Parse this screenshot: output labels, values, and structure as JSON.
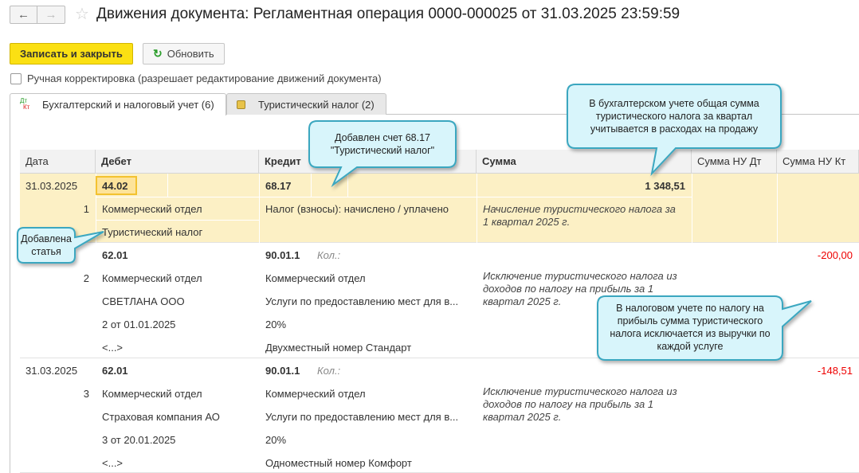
{
  "header": {
    "title": "Движения документа: Регламентная операция 0000-000025 от 31.03.2025 23:59:59",
    "back_icon": "arrow-left-icon",
    "forward_icon": "arrow-right-icon",
    "favorite_icon": "star-icon"
  },
  "toolbar": {
    "save_close_label": "Записать и закрыть",
    "refresh_label": "Обновить"
  },
  "manual_edit": {
    "label": "Ручная корректировка (разрешает редактирование движений документа)",
    "checked": false
  },
  "tabs": [
    {
      "icon_text_top": "Дт",
      "icon_text_bottom": "Кт",
      "label": "Бухгалтерский и налоговый учет (6)",
      "active": true
    },
    {
      "icon": "coins-icon",
      "label": "Туристический налог (2)",
      "active": false
    }
  ],
  "table": {
    "columns": [
      "Дата",
      "Дебет",
      "Кредит",
      "Сумма",
      "Сумма НУ Дт",
      "Сумма НУ Кт"
    ],
    "rows": [
      {
        "date": "31.03.2025",
        "num": "1",
        "debit": [
          "44.02",
          "Коммерческий отдел",
          "Туристический налог"
        ],
        "credit": [
          "68.17",
          "Налог (взносы): начислено / уплачено"
        ],
        "qty_label": "",
        "sum": "1 348,51",
        "comment": [
          "Начисление туристического налога за",
          "1 квартал 2025 г."
        ],
        "nu_dt": "",
        "nu_kt": "",
        "selected": true
      },
      {
        "date": "",
        "num": "2",
        "debit": [
          "62.01",
          "Коммерческий отдел",
          "СВЕТЛАНА ООО",
          "2 от 01.01.2025",
          "<...>"
        ],
        "credit": [
          "90.01.1",
          "Коммерческий отдел",
          "Услуги по предоставлению мест для в...",
          "20%",
          "Двухместный номер Стандарт"
        ],
        "qty_label": "Кол.:",
        "sum": "",
        "comment": [
          "Исключение туристического налога из",
          "доходов по налогу на прибыль за 1",
          "квартал 2025 г."
        ],
        "nu_dt": "",
        "nu_kt": "-200,00"
      },
      {
        "date": "31.03.2025",
        "num": "3",
        "debit": [
          "62.01",
          "Коммерческий отдел",
          "Страховая компания АО",
          "3 от 20.01.2025",
          "<...>"
        ],
        "credit": [
          "90.01.1",
          "Коммерческий отдел",
          "Услуги по предоставлению мест для в...",
          "20%",
          "Одноместный номер Комфорт"
        ],
        "qty_label": "Кол.:",
        "sum": "",
        "comment": [
          "Исключение туристического налога из",
          "доходов по налогу на прибыль за 1",
          "квартал 2025 г."
        ],
        "nu_dt": "",
        "nu_kt": "-148,51"
      }
    ]
  },
  "callouts": [
    {
      "lines": [
        "Добавлен счет 68.17",
        "\"Туристический налог\""
      ]
    },
    {
      "lines": [
        "В бухгалтерском учете общая сумма",
        "туристического налога за квартал",
        "учитывается в расходах на продажу"
      ]
    },
    {
      "lines": [
        "Добавлена",
        "статья"
      ]
    },
    {
      "lines": [
        "В налоговом учете по налогу на",
        "прибыль сумма туристического",
        "налога исключается из выручки по",
        "каждой услуге"
      ]
    }
  ],
  "colors": {
    "primary_button": "#fbe013",
    "selected_row": "#fcf0c5",
    "callout_fill": "#d8f5fb",
    "callout_border": "#3aa7c0",
    "negative": "#e00000"
  }
}
